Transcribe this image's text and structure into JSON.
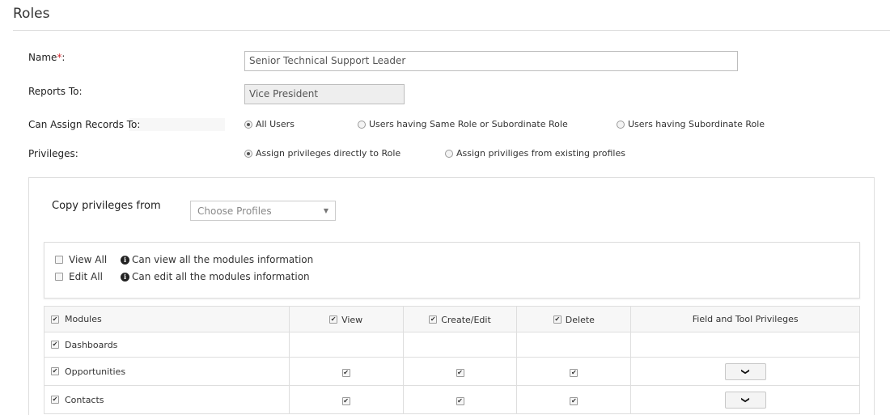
{
  "page": {
    "title": "Roles"
  },
  "form": {
    "name_label": "Name",
    "required_mark": "*",
    "name_colon": ":",
    "name_value": "Senior Technical Support Leader",
    "reports_to_label": "Reports To:",
    "reports_to_value": "Vice President",
    "assign_label": "Can Assign Records To:",
    "assign_options": [
      {
        "label": "All Users",
        "checked": true
      },
      {
        "label": "Users having Same Role or Subordinate Role",
        "checked": false
      },
      {
        "label": "Users having Subordinate Role",
        "checked": false
      }
    ],
    "privileges_label": "Privileges:",
    "privilege_options": [
      {
        "label": "Assign privileges directly to Role",
        "checked": true
      },
      {
        "label": "Assign priviliges from existing profiles",
        "checked": false
      }
    ]
  },
  "copy": {
    "label": "Copy privileges from",
    "select_placeholder": "Choose Profiles"
  },
  "all_options": {
    "view_all_label": "View All",
    "view_all_info": "Can view all the modules information",
    "edit_all_label": "Edit All",
    "edit_all_info": "Can edit all the modules information"
  },
  "table": {
    "headers": {
      "modules": "Modules",
      "view": "View",
      "create_edit": "Create/Edit",
      "delete": "Delete",
      "field_tool": "Field and Tool Privileges"
    },
    "rows": [
      {
        "module": "Dashboards",
        "checked": true,
        "view": false,
        "create_edit": false,
        "delete": false,
        "expandable": false
      },
      {
        "module": "Opportunities",
        "checked": true,
        "view": true,
        "create_edit": true,
        "delete": true,
        "expandable": true
      },
      {
        "module": "Contacts",
        "checked": true,
        "view": true,
        "create_edit": true,
        "delete": true,
        "expandable": true
      }
    ]
  },
  "icons": {
    "info": "info-icon",
    "expand": "chevron-down-icon",
    "select_caret": "caret-down-icon"
  },
  "colors": {
    "required": "#d4252b",
    "border": "#dedede",
    "readonly_bg": "#eeeeee"
  }
}
